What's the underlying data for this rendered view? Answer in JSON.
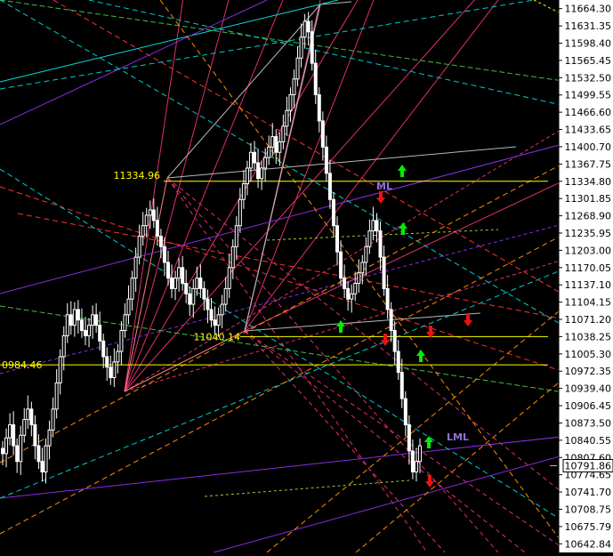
{
  "chart_data": {
    "type": "candlestick",
    "ylim": [
      10626.37,
      11680.77
    ],
    "y_ticks": [
      "11664.30",
      "11631.35",
      "11598.40",
      "11565.45",
      "11532.50",
      "11499.55",
      "11466.60",
      "11433.65",
      "11400.70",
      "11367.75",
      "11334.80",
      "11301.85",
      "11268.90",
      "11235.95",
      "11203.00",
      "11170.05",
      "11137.10",
      "11104.15",
      "11071.20",
      "11038.25",
      "11005.30",
      "10972.35",
      "10939.40",
      "10906.45",
      "10873.50",
      "10840.55",
      "10807.60",
      "10774.65",
      "10741.70",
      "10708.75",
      "10675.79",
      "10642.84"
    ],
    "current_price": "10791.86",
    "labels": {
      "pivot_high": "11334.96",
      "pivot_low": "11040.14",
      "left_level": "0984.46",
      "ml": "ML",
      "lml": "LML"
    },
    "horizontal_levels": [
      11334.8,
      11038.25,
      10984.46
    ],
    "closes": [
      10815,
      10845,
      10870,
      10830,
      10800,
      10850,
      10880,
      10900,
      10870,
      10830,
      10800,
      10780,
      10830,
      10860,
      10900,
      10950,
      11000,
      11040,
      11080,
      11060,
      11090,
      11070,
      11050,
      11040,
      11060,
      11080,
      11060,
      11030,
      11000,
      10980,
      10960,
      10990,
      11010,
      11050,
      11080,
      11110,
      11150,
      11190,
      11230,
      11250,
      11270,
      11280,
      11260,
      11230,
      11210,
      11180,
      11150,
      11130,
      11150,
      11170,
      11140,
      11120,
      11100,
      11130,
      11150,
      11130,
      11110,
      11090,
      11070,
      11060,
      11080,
      11100,
      11130,
      11170,
      11210,
      11250,
      11300,
      11330,
      11360,
      11390,
      11370,
      11340,
      11360,
      11380,
      11400,
      11420,
      11390,
      11410,
      11440,
      11470,
      11500,
      11530,
      11570,
      11610,
      11640,
      11620,
      11560,
      11500,
      11450,
      11400,
      11350,
      11300,
      11250,
      11200,
      11150,
      11130,
      11110,
      11120,
      11140,
      11160,
      11180,
      11210,
      11240,
      11260,
      11240,
      11190,
      11130,
      11090,
      11050,
      11010,
      10970,
      10920,
      10870,
      10820,
      10780,
      10800,
      10830
    ]
  }
}
